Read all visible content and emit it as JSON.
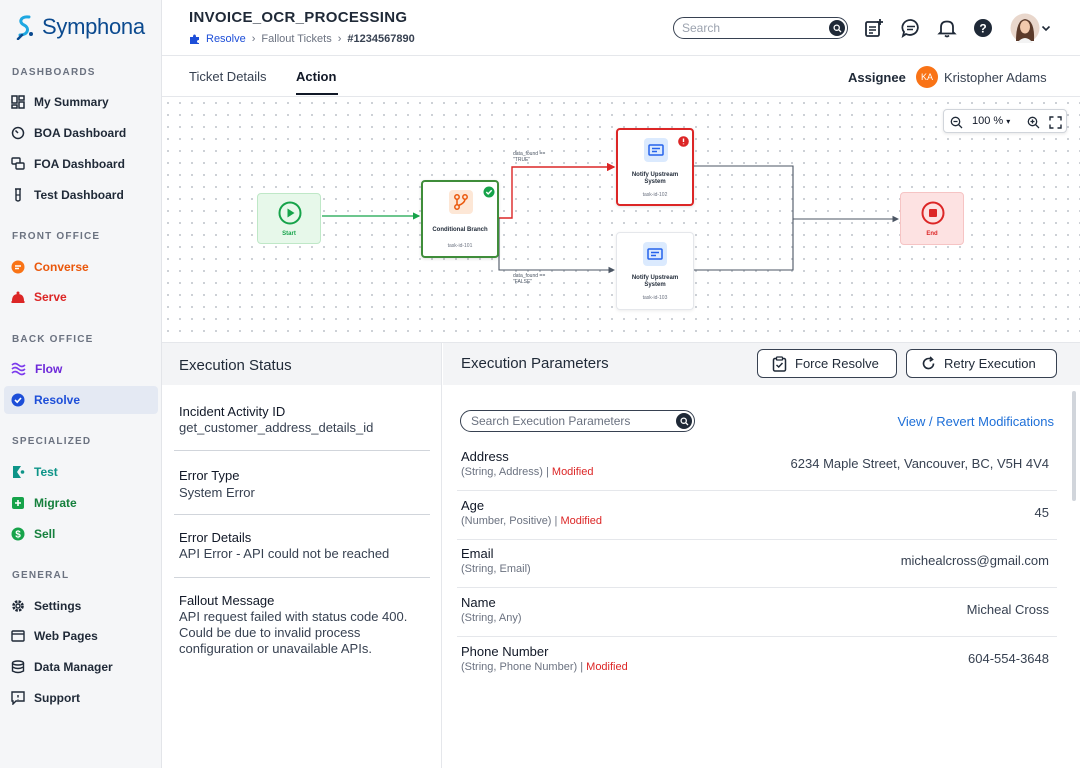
{
  "app": {
    "logo_text": "Symphona"
  },
  "sidebar": {
    "sections": [
      {
        "title": "DASHBOARDS",
        "items": [
          {
            "label": "My Summary",
            "icon": "grid-icon"
          },
          {
            "label": "BOA Dashboard",
            "icon": "gauge-icon"
          },
          {
            "label": "FOA Dashboard",
            "icon": "chat-bubbles-icon"
          },
          {
            "label": "Test Dashboard",
            "icon": "flask-icon"
          }
        ]
      },
      {
        "title": "FRONT OFFICE",
        "items": [
          {
            "label": "Converse",
            "icon": "converse-icon",
            "color": "#f97316"
          },
          {
            "label": "Serve",
            "icon": "serve-icon",
            "color": "#dc2626"
          }
        ]
      },
      {
        "title": "BACK OFFICE",
        "items": [
          {
            "label": "Flow",
            "icon": "waves-icon",
            "color": "#7c3aed"
          },
          {
            "label": "Resolve",
            "icon": "check-badge-icon",
            "color": "#1d4ed8",
            "active": true
          }
        ]
      },
      {
        "title": "SPECIALIZED",
        "items": [
          {
            "label": "Test",
            "icon": "test-icon",
            "color": "#0d9488"
          },
          {
            "label": "Migrate",
            "icon": "migrate-icon",
            "color": "#16a34a"
          },
          {
            "label": "Sell",
            "icon": "dollar-icon",
            "color": "#16a34a"
          }
        ]
      },
      {
        "title": "GENERAL",
        "items": [
          {
            "label": "Settings",
            "icon": "gear-icon"
          },
          {
            "label": "Web Pages",
            "icon": "browser-icon"
          },
          {
            "label": "Data Manager",
            "icon": "database-icon"
          },
          {
            "label": "Support",
            "icon": "support-icon"
          }
        ]
      }
    ]
  },
  "header": {
    "title": "INVOICE_OCR_PROCESSING",
    "breadcrumb": [
      "Resolve",
      "Fallout Tickets",
      "#1234567890"
    ],
    "search_placeholder": "Search"
  },
  "tabs": [
    {
      "label": "Ticket Details",
      "active": false
    },
    {
      "label": "Action",
      "active": true
    }
  ],
  "assignee": {
    "label": "Assignee",
    "initials": "KA",
    "name": "Kristopher Adams"
  },
  "flow": {
    "zoom": "100 %",
    "nodes": {
      "start": {
        "label": "Start"
      },
      "branch": {
        "label": "Conditional Branch",
        "task": "task-id-101"
      },
      "notify_true": {
        "label_1": "Notify Upstream",
        "label_2": "System",
        "task": "task-id-102"
      },
      "notify_false": {
        "label_1": "Notify Upstream",
        "label_2": "System",
        "task": "task-id-103"
      },
      "end": {
        "label": "End"
      }
    },
    "edges": {
      "true_line1": "data_found ==",
      "true_line2": "\"TRUE\"",
      "false_line1": "data_found ==",
      "false_line2": "\"FALSE\""
    }
  },
  "execution_status": {
    "title": "Execution Status",
    "fields": [
      {
        "label": "Incident Activity ID",
        "value": "get_customer_address_details_id"
      },
      {
        "label": "Error Type",
        "value": "System Error"
      },
      {
        "label": "Error Details",
        "value": "API Error - API could not be reached"
      },
      {
        "label": "Fallout Message",
        "value": "API request failed with status code 400. Could be due to invalid process configuration or unavailable APIs."
      }
    ]
  },
  "execution_parameters": {
    "title": "Execution Parameters",
    "force_resolve": "Force Resolve",
    "retry_execution": "Retry Execution",
    "search_placeholder": "Search Execution Parameters",
    "revert_link": "View / Revert Modifications",
    "modified_label": "Modified",
    "params": [
      {
        "name": "Address",
        "type": "(String, Address)",
        "modified": true,
        "value": "6234 Maple Street, Vancouver, BC, V5H 4V4"
      },
      {
        "name": "Age",
        "type": "(Number, Positive)",
        "modified": true,
        "value": "45"
      },
      {
        "name": "Email",
        "type": "(String, Email)",
        "modified": false,
        "value": "michealcross@gmail.com"
      },
      {
        "name": "Name",
        "type": "(String, Any)",
        "modified": false,
        "value": "Micheal Cross"
      },
      {
        "name": "Phone Number",
        "type": "(String, Phone Number)",
        "modified": true,
        "value": "604-554-3648"
      }
    ]
  },
  "colors": {
    "accent": "#1d4ed8",
    "error": "#dc2626",
    "success": "#16a34a",
    "brand": "#0b4a8f"
  }
}
